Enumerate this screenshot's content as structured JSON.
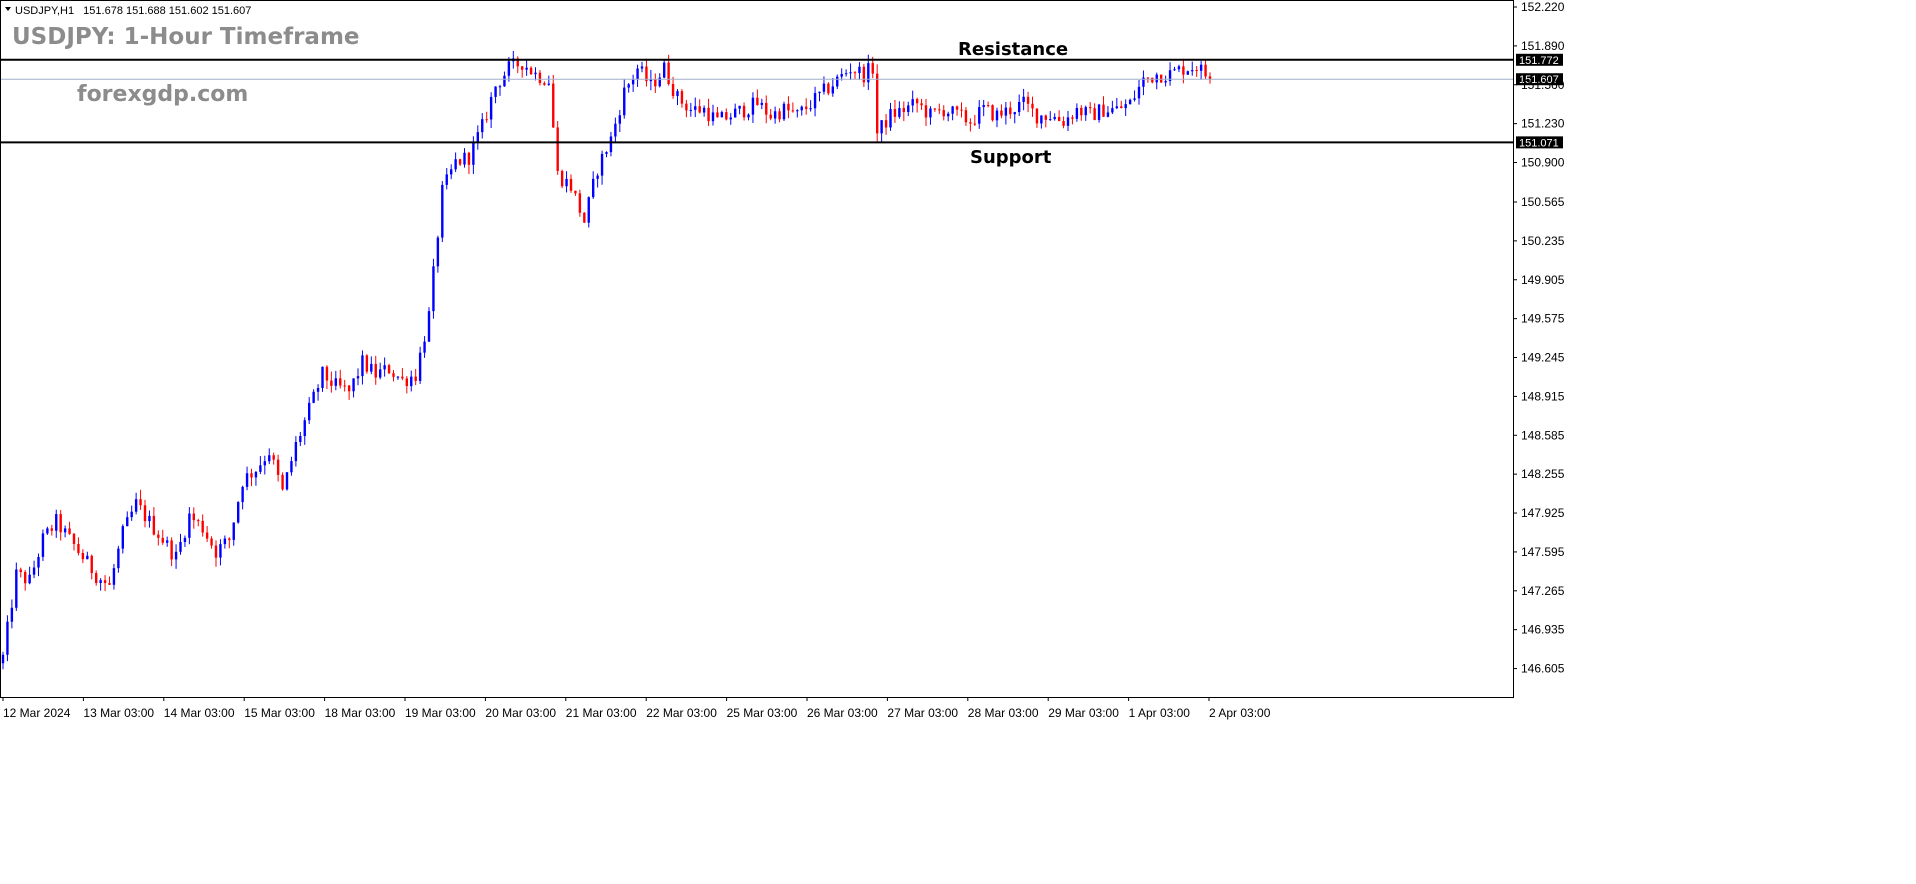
{
  "header": {
    "symbol_label": "USDJPY,H1",
    "ohlc": "151.678 151.688 151.602 151.607",
    "dropdown_icon": "triangle-down-icon"
  },
  "overlay": {
    "title": "USDJPY: 1-Hour Timeframe",
    "watermark": "forexgdp.com"
  },
  "annotations": {
    "resistance_label": "Resistance",
    "support_label": "Support",
    "resistance_value": "151.772",
    "support_value": "151.071",
    "current_value": "151.607"
  },
  "colors": {
    "bull": "#0000ff",
    "bear": "#ff0000",
    "level_line": "#000000",
    "current_line": "#a0b0c8",
    "title_gray": "#8c8c8c"
  },
  "chart_data": {
    "type": "candlestick",
    "title": "USDJPY: 1-Hour Timeframe",
    "ylim": [
      146.44,
      152.22
    ],
    "y_ticks": [
      "152.220",
      "151.890",
      "151.560",
      "151.230",
      "150.900",
      "150.565",
      "150.235",
      "149.905",
      "149.575",
      "149.245",
      "148.915",
      "148.585",
      "148.255",
      "147.925",
      "147.595",
      "147.265",
      "146.935",
      "146.605"
    ],
    "x_ticks": [
      "12 Mar 2024",
      "13 Mar 03:00",
      "14 Mar 03:00",
      "15 Mar 03:00",
      "18 Mar 03:00",
      "19 Mar 03:00",
      "20 Mar 03:00",
      "21 Mar 03:00",
      "22 Mar 03:00",
      "25 Mar 03:00",
      "26 Mar 03:00",
      "27 Mar 03:00",
      "28 Mar 03:00",
      "29 Mar 03:00",
      "1 Apr 03:00",
      "2 Apr 03:00"
    ],
    "grid": false,
    "levels": [
      {
        "name": "Resistance",
        "value": 151.772
      },
      {
        "name": "Support",
        "value": 151.071
      }
    ],
    "current_price": 151.607,
    "close_path": [
      [
        0,
        146.7
      ],
      [
        3,
        147.4
      ],
      [
        6,
        147.35
      ],
      [
        9,
        147.7
      ],
      [
        12,
        147.85
      ],
      [
        15,
        147.7
      ],
      [
        18,
        147.55
      ],
      [
        21,
        147.4
      ],
      [
        24,
        147.3
      ],
      [
        27,
        147.75
      ],
      [
        30,
        148.0
      ],
      [
        33,
        147.85
      ],
      [
        36,
        147.7
      ],
      [
        39,
        147.55
      ],
      [
        42,
        147.9
      ],
      [
        45,
        147.8
      ],
      [
        48,
        147.6
      ],
      [
        51,
        147.7
      ],
      [
        54,
        148.2
      ],
      [
        57,
        148.3
      ],
      [
        60,
        148.45
      ],
      [
        63,
        148.1
      ],
      [
        66,
        148.5
      ],
      [
        69,
        148.8
      ],
      [
        72,
        149.1
      ],
      [
        75,
        149.0
      ],
      [
        78,
        148.95
      ],
      [
        81,
        149.2
      ],
      [
        84,
        149.1
      ],
      [
        87,
        149.15
      ],
      [
        90,
        149.05
      ],
      [
        93,
        149.1
      ],
      [
        96,
        149.6
      ],
      [
        99,
        150.65
      ],
      [
        102,
        150.9
      ],
      [
        105,
        150.95
      ],
      [
        108,
        151.2
      ],
      [
        111,
        151.55
      ],
      [
        114,
        151.7
      ],
      [
        117,
        151.75
      ],
      [
        120,
        151.65
      ],
      [
        123,
        151.6
      ],
      [
        125,
        150.8
      ],
      [
        128,
        150.7
      ],
      [
        131,
        150.4
      ],
      [
        134,
        150.85
      ],
      [
        137,
        151.1
      ],
      [
        140,
        151.5
      ],
      [
        143,
        151.7
      ],
      [
        146,
        151.55
      ],
      [
        149,
        151.7
      ],
      [
        152,
        151.45
      ],
      [
        155,
        151.35
      ],
      [
        158,
        151.35
      ],
      [
        161,
        151.25
      ],
      [
        164,
        151.3
      ],
      [
        167,
        151.35
      ],
      [
        170,
        151.4
      ],
      [
        173,
        151.3
      ],
      [
        176,
        151.35
      ],
      [
        179,
        151.3
      ],
      [
        182,
        151.4
      ],
      [
        185,
        151.5
      ],
      [
        188,
        151.6
      ],
      [
        191,
        151.7
      ],
      [
        194,
        151.65
      ],
      [
        196,
        151.7
      ],
      [
        197,
        151.15
      ],
      [
        200,
        151.3
      ],
      [
        203,
        151.35
      ],
      [
        206,
        151.4
      ],
      [
        209,
        151.3
      ],
      [
        212,
        151.35
      ],
      [
        215,
        151.3
      ],
      [
        218,
        151.25
      ],
      [
        221,
        151.35
      ],
      [
        224,
        151.3
      ],
      [
        227,
        151.35
      ],
      [
        230,
        151.4
      ],
      [
        233,
        151.3
      ],
      [
        236,
        151.3
      ],
      [
        239,
        151.25
      ],
      [
        242,
        151.35
      ],
      [
        245,
        151.3
      ],
      [
        248,
        151.35
      ],
      [
        251,
        151.35
      ],
      [
        254,
        151.4
      ],
      [
        257,
        151.6
      ],
      [
        260,
        151.65
      ],
      [
        263,
        151.65
      ],
      [
        266,
        151.7
      ],
      [
        269,
        151.72
      ],
      [
        272,
        151.607
      ]
    ]
  }
}
